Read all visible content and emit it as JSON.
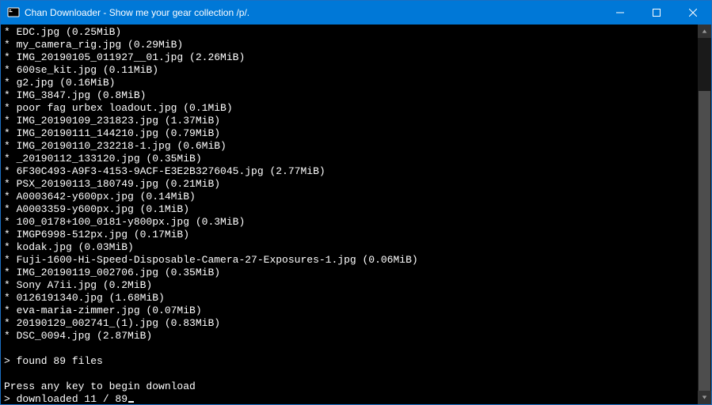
{
  "window": {
    "title": "Chan Downloader - Show me your gear collection /p/."
  },
  "files": [
    {
      "name": "EDC.jpg",
      "size": "0.25MiB"
    },
    {
      "name": "my_camera_rig.jpg",
      "size": "0.29MiB"
    },
    {
      "name": "IMG_20190105_011927__01.jpg",
      "size": "2.26MiB"
    },
    {
      "name": "600se_kit.jpg",
      "size": "0.11MiB"
    },
    {
      "name": "g2.jpg",
      "size": "0.16MiB"
    },
    {
      "name": "IMG_3847.jpg",
      "size": "0.8MiB"
    },
    {
      "name": "poor fag urbex loadout.jpg",
      "size": "0.1MiB"
    },
    {
      "name": "IMG_20190109_231823.jpg",
      "size": "1.37MiB"
    },
    {
      "name": "IMG_20190111_144210.jpg",
      "size": "0.79MiB"
    },
    {
      "name": "IMG_20190110_232218-1.jpg",
      "size": "0.6MiB"
    },
    {
      "name": "_20190112_133120.jpg",
      "size": "0.35MiB"
    },
    {
      "name": "6F30C493-A9F3-4153-9ACF-E3E2B3276045.jpg",
      "size": "2.77MiB"
    },
    {
      "name": "PSX_20190113_180749.jpg",
      "size": "0.21MiB"
    },
    {
      "name": "A0003642-y600px.jpg",
      "size": "0.14MiB"
    },
    {
      "name": "A0003359-y600px.jpg",
      "size": "0.1MiB"
    },
    {
      "name": "100_0178+100_0181-y800px.jpg",
      "size": "0.3MiB"
    },
    {
      "name": "IMGP6998-512px.jpg",
      "size": "0.17MiB"
    },
    {
      "name": "kodak.jpg",
      "size": "0.03MiB"
    },
    {
      "name": "Fuji-1600-Hi-Speed-Disposable-Camera-27-Exposures-1.jpg",
      "size": "0.06MiB"
    },
    {
      "name": "IMG_20190119_002706.jpg",
      "size": "0.35MiB"
    },
    {
      "name": "Sony A7ii.jpg",
      "size": "0.2MiB"
    },
    {
      "name": "0126191340.jpg",
      "size": "1.68MiB"
    },
    {
      "name": "eva-maria-zimmer.jpg",
      "size": "0.07MiB"
    },
    {
      "name": "20190129_002741_(1).jpg",
      "size": "0.83MiB"
    },
    {
      "name": "DSC_0094.jpg",
      "size": "2.87MiB"
    }
  ],
  "status": {
    "found_prefix": "> found ",
    "found_count": "89",
    "found_suffix": " files",
    "prompt": "Press any key to begin download",
    "progress_prefix": "> downloaded ",
    "progress_current": "11",
    "progress_sep": " / ",
    "progress_total": "89"
  }
}
